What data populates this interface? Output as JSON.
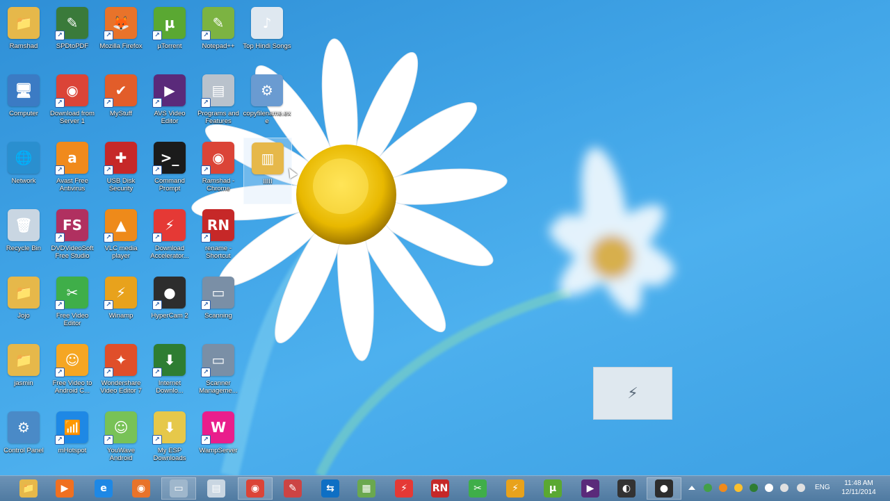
{
  "desktop": {
    "icons": [
      {
        "label": "Ramshad",
        "icon": "folder-user-icon",
        "color": "#e6b84a",
        "glyph": "📁",
        "shortcut": false
      },
      {
        "label": "SPDtoPDF",
        "icon": "crayons-icon",
        "color": "#3a7a3a",
        "glyph": "✎",
        "shortcut": true
      },
      {
        "label": "Mozilla Firefox",
        "icon": "firefox-icon",
        "color": "#e8732a",
        "glyph": "🦊",
        "shortcut": true
      },
      {
        "label": "µTorrent",
        "icon": "utorrent-icon",
        "color": "#5aa832",
        "glyph": "µ",
        "shortcut": true
      },
      {
        "label": "Notepad++",
        "icon": "notepadpp-icon",
        "color": "#7cb342",
        "glyph": "✎",
        "shortcut": true
      },
      {
        "label": "Top Hindi Songs",
        "icon": "music-file-icon",
        "color": "#dfe8f0",
        "glyph": "♪",
        "shortcut": false
      },
      {
        "label": "Computer",
        "icon": "computer-icon",
        "color": "#3b7bc4",
        "glyph": "🖥",
        "shortcut": false
      },
      {
        "label": "Download from Server 1",
        "icon": "chrome-icon",
        "color": "#db4437",
        "glyph": "◉",
        "shortcut": true
      },
      {
        "label": "MyStuff",
        "icon": "checklist-icon",
        "color": "#e25d2a",
        "glyph": "✔",
        "shortcut": true
      },
      {
        "label": "AVS Video Editor",
        "icon": "video-editor-icon",
        "color": "#5a2a7a",
        "glyph": "▶",
        "shortcut": true
      },
      {
        "label": "Programs and Features",
        "icon": "programs-icon",
        "color": "#b9c2cc",
        "glyph": "▤",
        "shortcut": true
      },
      {
        "label": "copyfilename.exe",
        "icon": "installer-icon",
        "color": "#6a9bd1",
        "glyph": "⚙",
        "shortcut": false
      },
      {
        "label": "Network",
        "icon": "network-icon",
        "color": "#2a8fcf",
        "glyph": "🌐",
        "shortcut": false
      },
      {
        "label": "Avast Free Antivirus",
        "icon": "avast-icon",
        "color": "#f08a1c",
        "glyph": "a",
        "shortcut": true
      },
      {
        "label": "USB Disk Security",
        "icon": "shield-icon",
        "color": "#c62828",
        "glyph": "✚",
        "shortcut": true
      },
      {
        "label": "Command Prompt",
        "icon": "cmd-icon",
        "color": "#1b1b1b",
        "glyph": ">_",
        "shortcut": true
      },
      {
        "label": "Ramshad - Chrome",
        "icon": "chrome-icon",
        "color": "#db4437",
        "glyph": "◉",
        "shortcut": true
      },
      {
        "label": "IIIII",
        "icon": "zip-folder-icon",
        "color": "#e6b84a",
        "glyph": "▥",
        "shortcut": false
      },
      {
        "label": "Recycle Bin",
        "icon": "recycle-bin-icon",
        "color": "#c9d6e2",
        "glyph": "🗑",
        "shortcut": false
      },
      {
        "label": "DVDVideoSoft Free Studio",
        "icon": "freestudio-icon",
        "color": "#b03060",
        "glyph": "FS",
        "shortcut": true
      },
      {
        "label": "VLC media player",
        "icon": "vlc-icon",
        "color": "#ee8a1a",
        "glyph": "▲",
        "shortcut": true
      },
      {
        "label": "Download Accelerator...",
        "icon": "dap-icon",
        "color": "#e53935",
        "glyph": "⚡",
        "shortcut": true
      },
      {
        "label": "rename - Shortcut",
        "icon": "rename-icon",
        "color": "#c62828",
        "glyph": "RN",
        "shortcut": true
      },
      {
        "label": "Jojo",
        "icon": "folder-icon",
        "color": "#e6b84a",
        "glyph": "📁",
        "shortcut": false
      },
      {
        "label": "Free Video Editor",
        "icon": "scissors-icon",
        "color": "#3fae49",
        "glyph": "✂",
        "shortcut": true
      },
      {
        "label": "Winamp",
        "icon": "winamp-icon",
        "color": "#e8a21c",
        "glyph": "⚡",
        "shortcut": true
      },
      {
        "label": "HyperCam 2",
        "icon": "hypercam-icon",
        "color": "#2d2d2d",
        "glyph": "●",
        "shortcut": true
      },
      {
        "label": "Scanning",
        "icon": "scanner-icon",
        "color": "#7a8fa6",
        "glyph": "▭",
        "shortcut": true
      },
      {
        "label": "jasmin",
        "icon": "folder-icon",
        "color": "#e6b84a",
        "glyph": "📁",
        "shortcut": false
      },
      {
        "label": "Free Video to Android C...",
        "icon": "android-converter-icon",
        "color": "#f5a623",
        "glyph": "☺",
        "shortcut": true
      },
      {
        "label": "Wondershare Video Editor 7",
        "icon": "magic-wand-icon",
        "color": "#e04f2a",
        "glyph": "✦",
        "shortcut": true
      },
      {
        "label": "Internet Downlo...",
        "icon": "idm-icon",
        "color": "#2e7d32",
        "glyph": "⬇",
        "shortcut": true
      },
      {
        "label": "Scanner Manageme...",
        "icon": "scanner-icon",
        "color": "#7a8fa6",
        "glyph": "▭",
        "shortcut": true
      },
      {
        "label": "Control Panel",
        "icon": "control-panel-icon",
        "color": "#4a8ac7",
        "glyph": "⚙",
        "shortcut": false
      },
      {
        "label": "mHotspot",
        "icon": "wifi-icon",
        "color": "#1e88e5",
        "glyph": "📶",
        "shortcut": true
      },
      {
        "label": "YouWave Android",
        "icon": "android-icon",
        "color": "#78c257",
        "glyph": "☺",
        "shortcut": true
      },
      {
        "label": "My ESP Downloads",
        "icon": "download-folder-icon",
        "color": "#e6c84a",
        "glyph": "⬇",
        "shortcut": true
      },
      {
        "label": "WampServer",
        "icon": "wampserver-icon",
        "color": "#e91e8c",
        "glyph": "W",
        "shortcut": true
      }
    ]
  },
  "drag_tooltip": {
    "glyph": "⚡",
    "icon": "dap-drag-icon"
  },
  "taskbar": {
    "items": [
      {
        "name": "file-explorer-icon",
        "glyph": "📁",
        "color": "#e6b84a",
        "active": false
      },
      {
        "name": "media-player-icon",
        "glyph": "▶",
        "color": "#f07020",
        "active": false
      },
      {
        "name": "internet-explorer-icon",
        "glyph": "e",
        "color": "#1e88e5",
        "active": false
      },
      {
        "name": "firefox-icon",
        "glyph": "◉",
        "color": "#e8732a",
        "active": false
      },
      {
        "name": "desktop-window-icon",
        "glyph": "▭",
        "color": "#9fb7cc",
        "active": true
      },
      {
        "name": "document-icon",
        "glyph": "▤",
        "color": "#c9d6e2",
        "active": false
      },
      {
        "name": "chrome-icon",
        "glyph": "◉",
        "color": "#db4437",
        "active": true
      },
      {
        "name": "paint-icon",
        "glyph": "✎",
        "color": "#c44",
        "active": false
      },
      {
        "name": "teamviewer-icon",
        "glyph": "⇆",
        "color": "#0e6fc4",
        "active": false
      },
      {
        "name": "image-viewer-icon",
        "glyph": "▦",
        "color": "#6aa84f",
        "active": false
      },
      {
        "name": "download-accelerator-icon",
        "glyph": "⚡",
        "color": "#e53935",
        "active": false
      },
      {
        "name": "rename-icon",
        "glyph": "RN",
        "color": "#c62828",
        "active": false
      },
      {
        "name": "scissors-icon",
        "glyph": "✂",
        "color": "#3fae49",
        "active": false
      },
      {
        "name": "winamp-icon",
        "glyph": "⚡",
        "color": "#e8a21c",
        "active": false
      },
      {
        "name": "utorrent-icon",
        "glyph": "µ",
        "color": "#5aa832",
        "active": false
      },
      {
        "name": "video-editor-icon",
        "glyph": "▶",
        "color": "#5a2a7a",
        "active": false
      },
      {
        "name": "audio-icon",
        "glyph": "◐",
        "color": "#333",
        "active": false
      },
      {
        "name": "hypercam-icon",
        "glyph": "●",
        "color": "#2d2d2d",
        "active": true
      }
    ],
    "tray_icons": [
      {
        "name": "show-hidden-icons-icon",
        "color": "#d0e0ee"
      },
      {
        "name": "network-tray-icon",
        "color": "#43a047"
      },
      {
        "name": "avast-tray-icon",
        "color": "#f08a1c"
      },
      {
        "name": "shield-tray-icon",
        "color": "#fbc02d"
      },
      {
        "name": "idm-tray-icon",
        "color": "#2e7d32"
      },
      {
        "name": "flag-tray-icon",
        "color": "#ffffff"
      },
      {
        "name": "battery-tray-icon",
        "color": "#e0e0e0"
      },
      {
        "name": "volume-tray-icon",
        "color": "#e0e0e0"
      }
    ],
    "language": "ENG",
    "time": "11:48 AM",
    "date": "12/11/2014"
  }
}
